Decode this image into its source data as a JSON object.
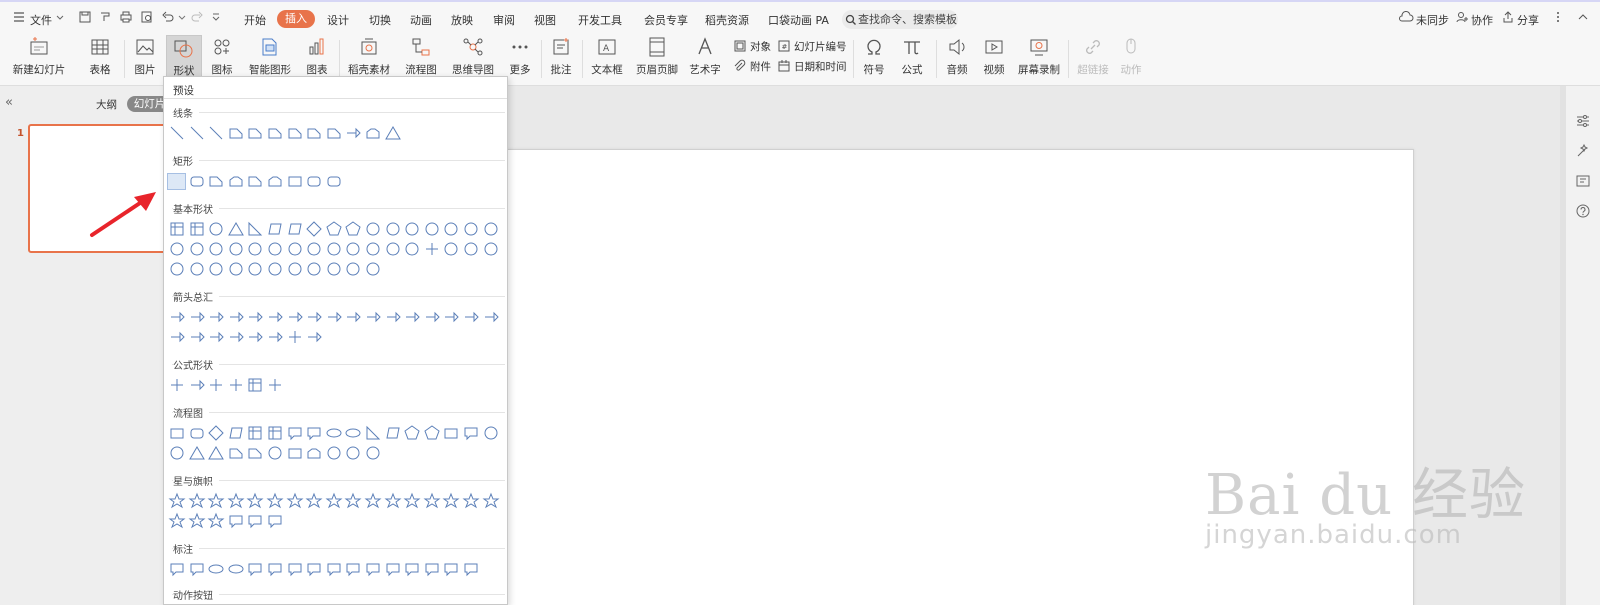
{
  "menu": {
    "file": "文件",
    "tabs": [
      "开始",
      "插入",
      "设计",
      "切换",
      "动画",
      "放映",
      "审阅",
      "视图",
      "开发工具",
      "会员专享",
      "稻壳资源",
      "口袋动画 PA"
    ],
    "active_tab": "插入",
    "search_placeholder": "查找命令、搜索模板",
    "sync": "未同步",
    "collab": "协作",
    "share": "分享"
  },
  "ribbon": {
    "new_slide": "新建幻灯片",
    "table": "表格",
    "picture": "图片",
    "shape": "形状",
    "icon": "图标",
    "smart_shape": "智能图形",
    "chart": "图表",
    "docer_material": "稻壳素材",
    "flowchart": "流程图",
    "mindmap": "思维导图",
    "more": "更多",
    "comment": "批注",
    "textbox": "文本框",
    "header_footer": "页眉页脚",
    "wordart": "艺术字",
    "object": "对象",
    "attachment": "附件",
    "slide_number": "幻灯片编号",
    "datetime": "日期和时间",
    "symbol": "符号",
    "formula": "公式",
    "audio": "音频",
    "video": "视频",
    "screen_record": "屏幕录制",
    "hyperlink": "超链接",
    "action": "动作"
  },
  "left_pane": {
    "outline": "大纲",
    "slides": "幻灯片",
    "slide_number": "1"
  },
  "shape_panel": {
    "title": "预设",
    "categories": [
      "线条",
      "矩形",
      "基本形状",
      "箭头总汇",
      "公式形状",
      "流程图",
      "星与旗帜",
      "标注",
      "动作按钮"
    ],
    "counts": [
      12,
      9,
      45,
      25,
      6,
      28,
      23,
      16
    ]
  },
  "watermark": {
    "logo": "Bai du 经验",
    "url": "jingyan.baidu.com"
  },
  "colors": {
    "accent": "#e8734a",
    "shape_stroke": "#5b7fb8",
    "annotation_arrow": "#e8242b"
  }
}
